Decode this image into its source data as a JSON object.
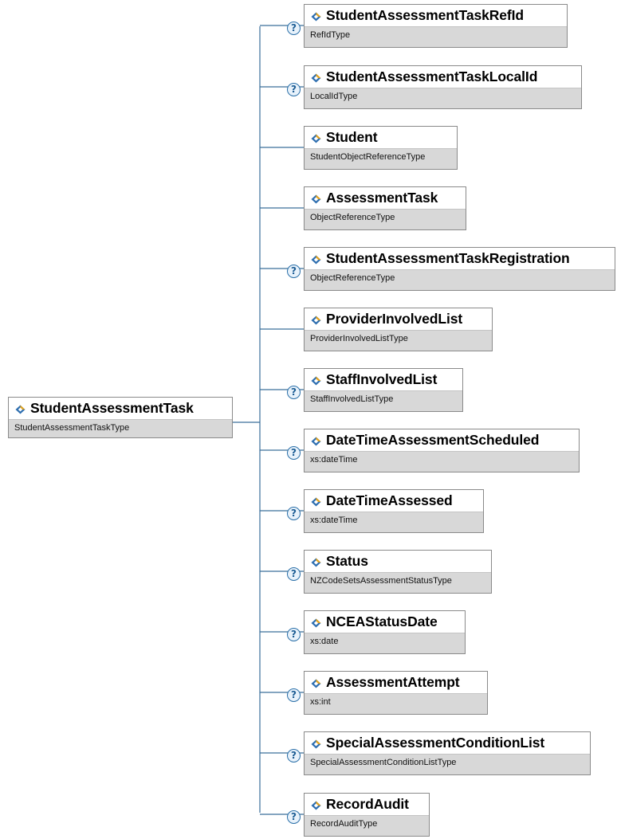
{
  "root": {
    "name": "StudentAssessmentTask",
    "type": "StudentAssessmentTaskType"
  },
  "elements": [
    {
      "name": "StudentAssessmentTaskRefId",
      "type": "RefIdType",
      "optional": true
    },
    {
      "name": "StudentAssessmentTaskLocalId",
      "type": "LocalIdType",
      "optional": true
    },
    {
      "name": "Student",
      "type": "StudentObjectReferenceType",
      "optional": false
    },
    {
      "name": "AssessmentTask",
      "type": "ObjectReferenceType",
      "optional": false
    },
    {
      "name": "StudentAssessmentTaskRegistration",
      "type": "ObjectReferenceType",
      "optional": true
    },
    {
      "name": "ProviderInvolvedList",
      "type": "ProviderInvolvedListType",
      "optional": false
    },
    {
      "name": "StaffInvolvedList",
      "type": "StaffInvolvedListType",
      "optional": true
    },
    {
      "name": "DateTimeAssessmentScheduled",
      "type": "xs:dateTime",
      "optional": true
    },
    {
      "name": "DateTimeAssessed",
      "type": "xs:dateTime",
      "optional": true
    },
    {
      "name": "Status",
      "type": "NZCodeSetsAssessmentStatusType",
      "optional": true
    },
    {
      "name": "NCEAStatusDate",
      "type": "xs:date",
      "optional": true
    },
    {
      "name": "AssessmentAttempt",
      "type": "xs:int",
      "optional": true
    },
    {
      "name": "SpecialAssessmentConditionList",
      "type": "SpecialAssessmentConditionListType",
      "optional": true
    },
    {
      "name": "RecordAudit",
      "type": "RecordAuditType",
      "optional": true
    }
  ],
  "optional_marker": "?",
  "colors": {
    "line": "#3a6f9a",
    "box_border": "#8a8a8a",
    "type_band": "#d8d8d8"
  },
  "icons": {
    "element": "element-diamond-icon",
    "optional": "question-mark-icon"
  }
}
